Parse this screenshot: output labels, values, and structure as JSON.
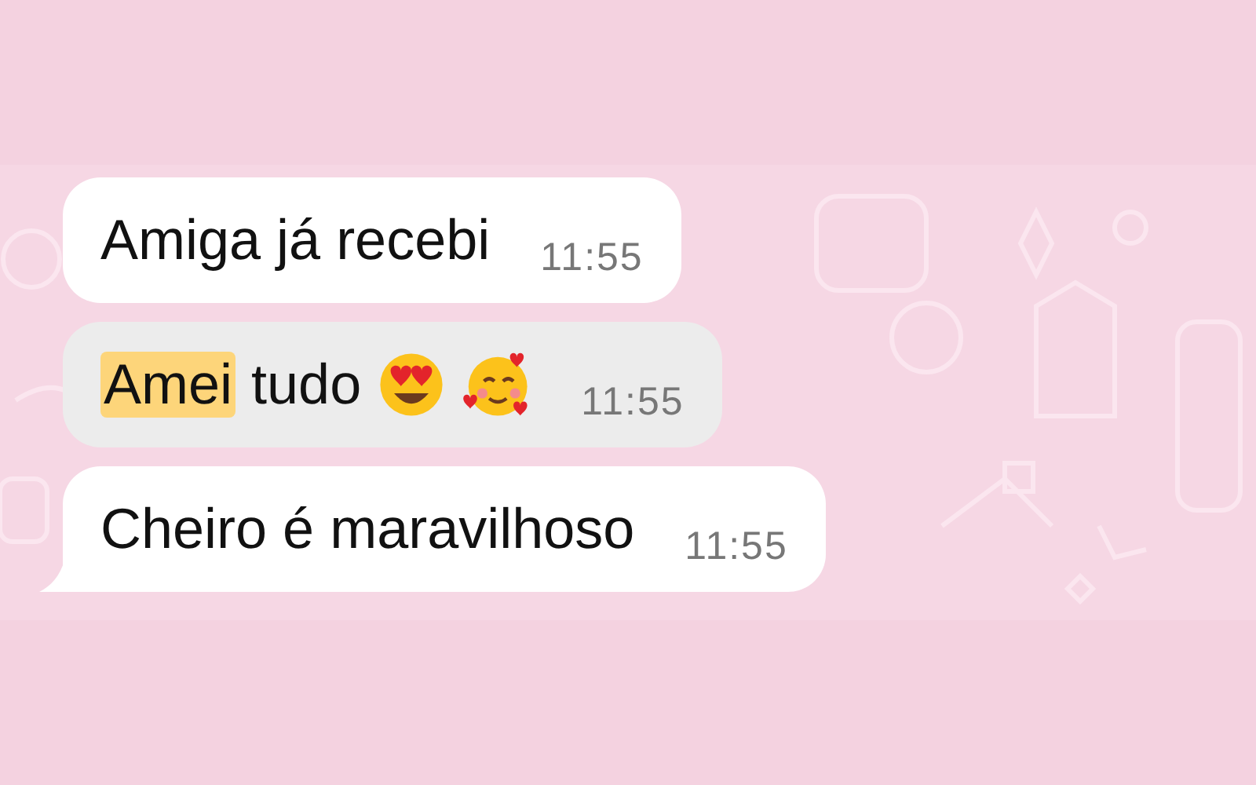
{
  "messages": [
    {
      "kind": "text",
      "text": "Amiga já recebi",
      "time": "11:55",
      "highlighted": false,
      "tail": false
    },
    {
      "kind": "with_emoji",
      "highlight": "Amei",
      "text": "tudo",
      "time": "11:55",
      "highlighted": true,
      "tail": false
    },
    {
      "kind": "text",
      "text": "Cheiro é maravilhoso",
      "time": "11:55",
      "highlighted": false,
      "tail": true
    }
  ]
}
